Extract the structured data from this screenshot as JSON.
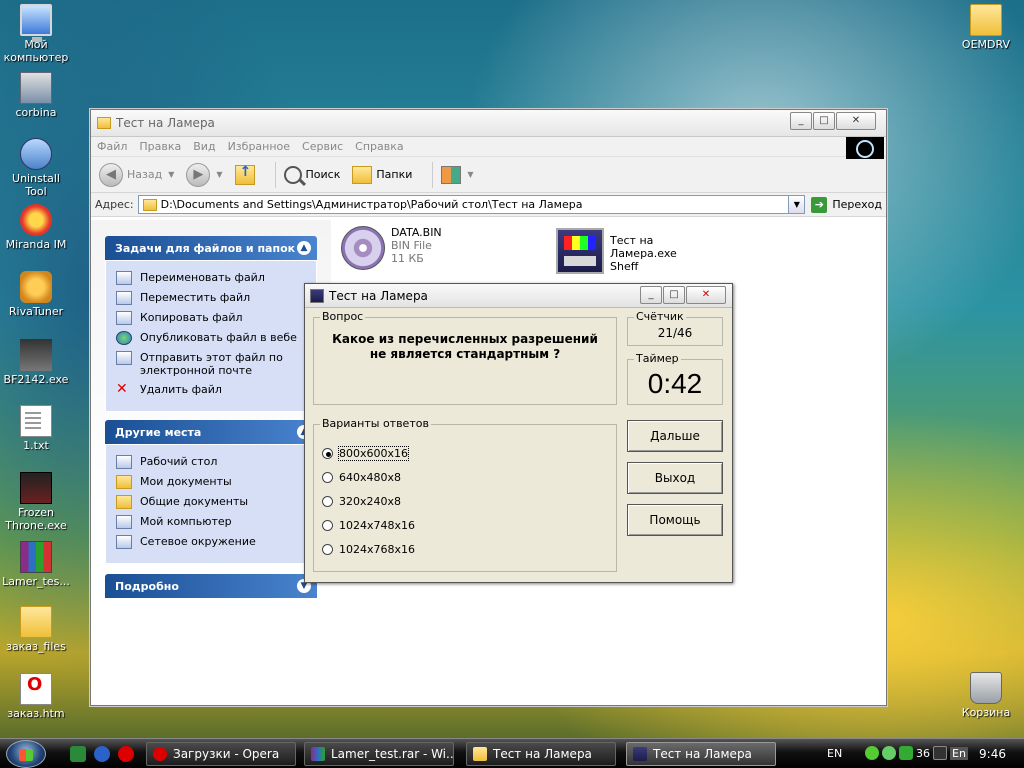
{
  "desktop": {
    "icons_left": [
      {
        "label": "Мой компьютер",
        "icon": "my-computer-icon"
      },
      {
        "label": "corbina",
        "icon": "network-connection-icon"
      },
      {
        "label": "Uninstall Tool",
        "icon": "uninstall-tool-icon"
      },
      {
        "label": "Miranda IM",
        "icon": "miranda-icon"
      },
      {
        "label": "RivaTuner",
        "icon": "rivatuner-icon"
      },
      {
        "label": "BF2142.exe",
        "icon": "bf2142-icon"
      },
      {
        "label": "1.txt",
        "icon": "text-file-icon"
      },
      {
        "label": "Frozen Throne.exe",
        "icon": "frozen-throne-icon"
      },
      {
        "label": "Lamer_tes...",
        "icon": "winrar-archive-icon"
      },
      {
        "label": "заказ_files",
        "icon": "folder-icon"
      },
      {
        "label": "заказ.htm",
        "icon": "opera-html-icon"
      }
    ],
    "icon_oemdrv": "OEMDRV",
    "icon_recycle": "Корзина"
  },
  "explorer": {
    "title": "Тест на Ламера",
    "menu": [
      "Файл",
      "Правка",
      "Вид",
      "Избранное",
      "Сервис",
      "Справка"
    ],
    "toolbar": {
      "back": "Назад",
      "search": "Поиск",
      "folders": "Папки"
    },
    "address_label": "Адрес:",
    "address_value": "D:\\Documents and Settings\\Администратор\\Рабочий стол\\Тест на Ламера",
    "go_label": "Переход",
    "tasks_title": "Задачи для файлов и папок",
    "tasks": [
      "Переименовать файл",
      "Переместить файл",
      "Копировать файл",
      "Опубликовать файл в вебе",
      "Отправить этот файл по электронной почте",
      "Удалить файл"
    ],
    "places_title": "Другие места",
    "places": [
      "Рабочий стол",
      "Мои документы",
      "Общие документы",
      "Мой компьютер",
      "Сетевое окружение"
    ],
    "details_title": "Подробно",
    "files": [
      {
        "name": "DATA.BIN",
        "type": "BIN File",
        "size": "11 КБ"
      },
      {
        "name": "Тест на Ламера.exe",
        "type": "Sheff"
      }
    ]
  },
  "dialog": {
    "title": "Тест на Ламера",
    "question_label": "Вопрос",
    "question_text": "Какое из перечисленных разрешений не является стандартным ?",
    "counter_label": "Счётчик",
    "counter_value": "21/46",
    "timer_label": "Таймер",
    "timer_value": "0:42",
    "answers_label": "Варианты ответов",
    "options": [
      "800x600x16",
      "640x480x8",
      "320x240x8",
      "1024x748x16",
      "1024x768x16"
    ],
    "selected_option": "800x600x16",
    "buttons": {
      "next": "Дальше",
      "exit": "Выход",
      "help": "Помощь"
    }
  },
  "taskbar": {
    "buttons": [
      "Загрузки - Opera",
      "Lamer_test.rar - Wi...",
      "Тест на Ламера",
      "Тест на Ламера"
    ],
    "active_button": "Тест на Ламера",
    "lang_1": "EN",
    "lang_2": "En",
    "tray_number": "36",
    "clock": "9:46"
  }
}
